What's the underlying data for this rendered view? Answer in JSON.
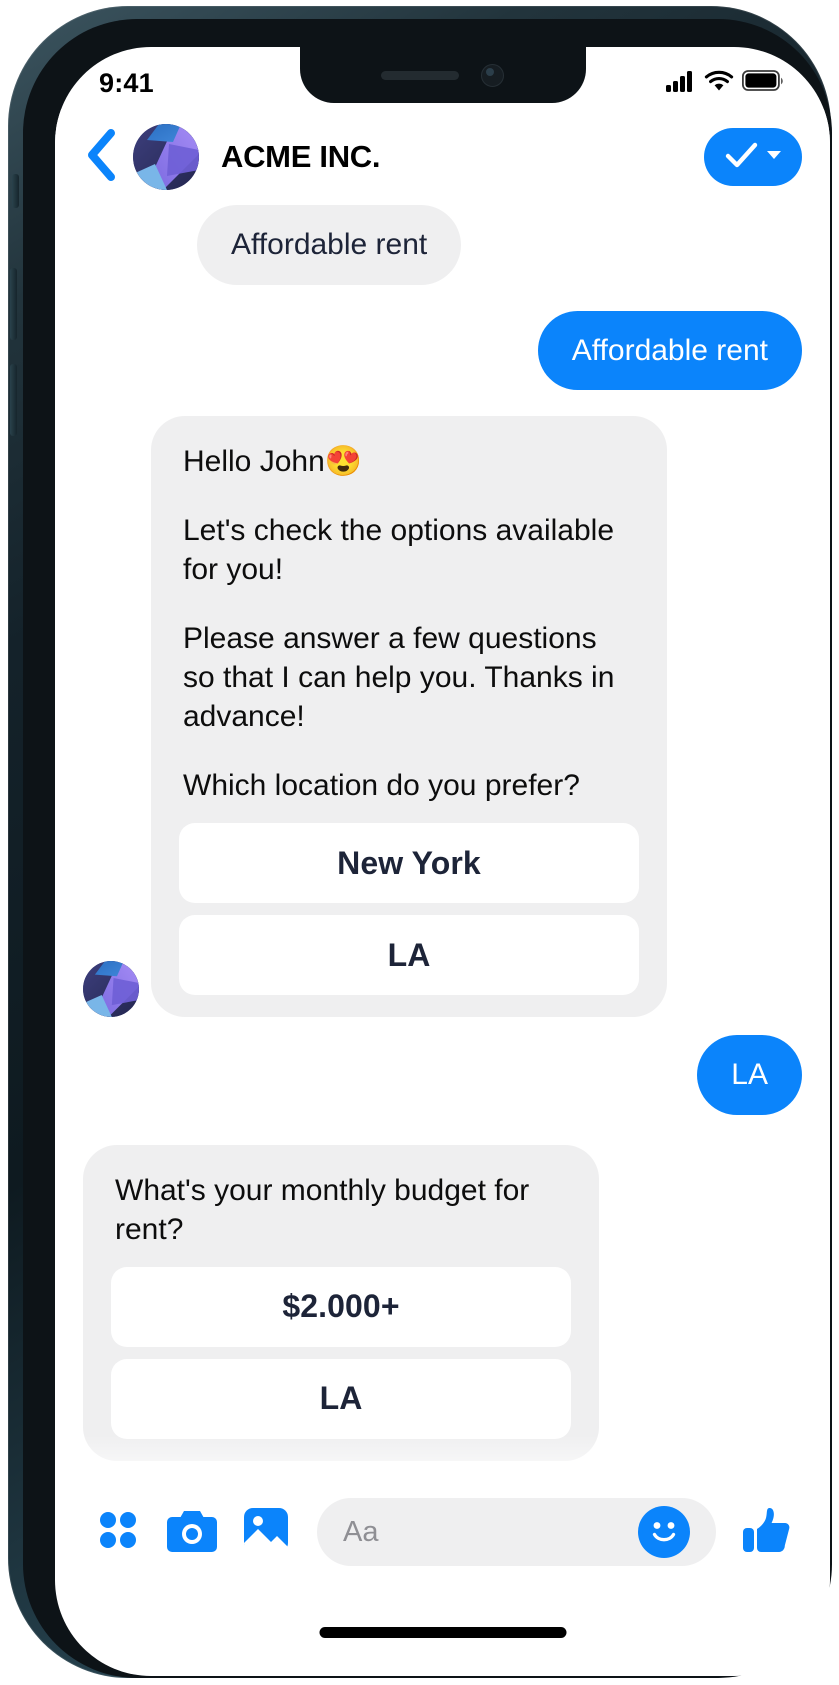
{
  "status_bar": {
    "time": "9:41",
    "icons": [
      "cellular-signal-icon",
      "wifi-icon",
      "battery-icon"
    ]
  },
  "header": {
    "back_icon": "chevron-left-icon",
    "avatar": "acme-logo-avatar",
    "brand_name": "ACME INC.",
    "action_icons": [
      "checkmark-icon",
      "chevron-down-icon"
    ]
  },
  "conversation": {
    "messages": [
      {
        "id": "m1",
        "side": "in",
        "type": "pill",
        "text": "Affordable rent"
      },
      {
        "id": "m2",
        "side": "out",
        "type": "pill",
        "text": "Affordable rent"
      },
      {
        "id": "m3",
        "side": "in",
        "type": "card",
        "paragraphs": [
          "Hello John😍",
          "Let's check the options available for you!",
          "Please answer a few questions so that I can help you. Thanks in advance!",
          "Which location do you prefer?"
        ],
        "quick_replies": [
          "New York",
          "LA"
        ]
      },
      {
        "id": "m4",
        "side": "out",
        "type": "pill",
        "text": "LA"
      },
      {
        "id": "m5",
        "side": "in",
        "type": "card",
        "paragraphs": [
          "What's your monthly budget for rent?"
        ],
        "quick_replies": [
          "$2.000+",
          "LA"
        ]
      }
    ]
  },
  "composer": {
    "tools": [
      {
        "name": "apps-grid-icon",
        "label": "Apps"
      },
      {
        "name": "camera-icon",
        "label": "Camera"
      },
      {
        "name": "gallery-icon",
        "label": "Gallery"
      }
    ],
    "input_placeholder": "Aa",
    "emoji_icon": "smiley-face-icon",
    "like_icon": "thumbs-up-icon"
  },
  "colors": {
    "accent_blue": "#0b84fb",
    "bubble_grey": "#efeff0",
    "text_navy": "#1d2438",
    "text_black": "#0d0d0d",
    "placeholder_grey": "#8f8f94"
  }
}
